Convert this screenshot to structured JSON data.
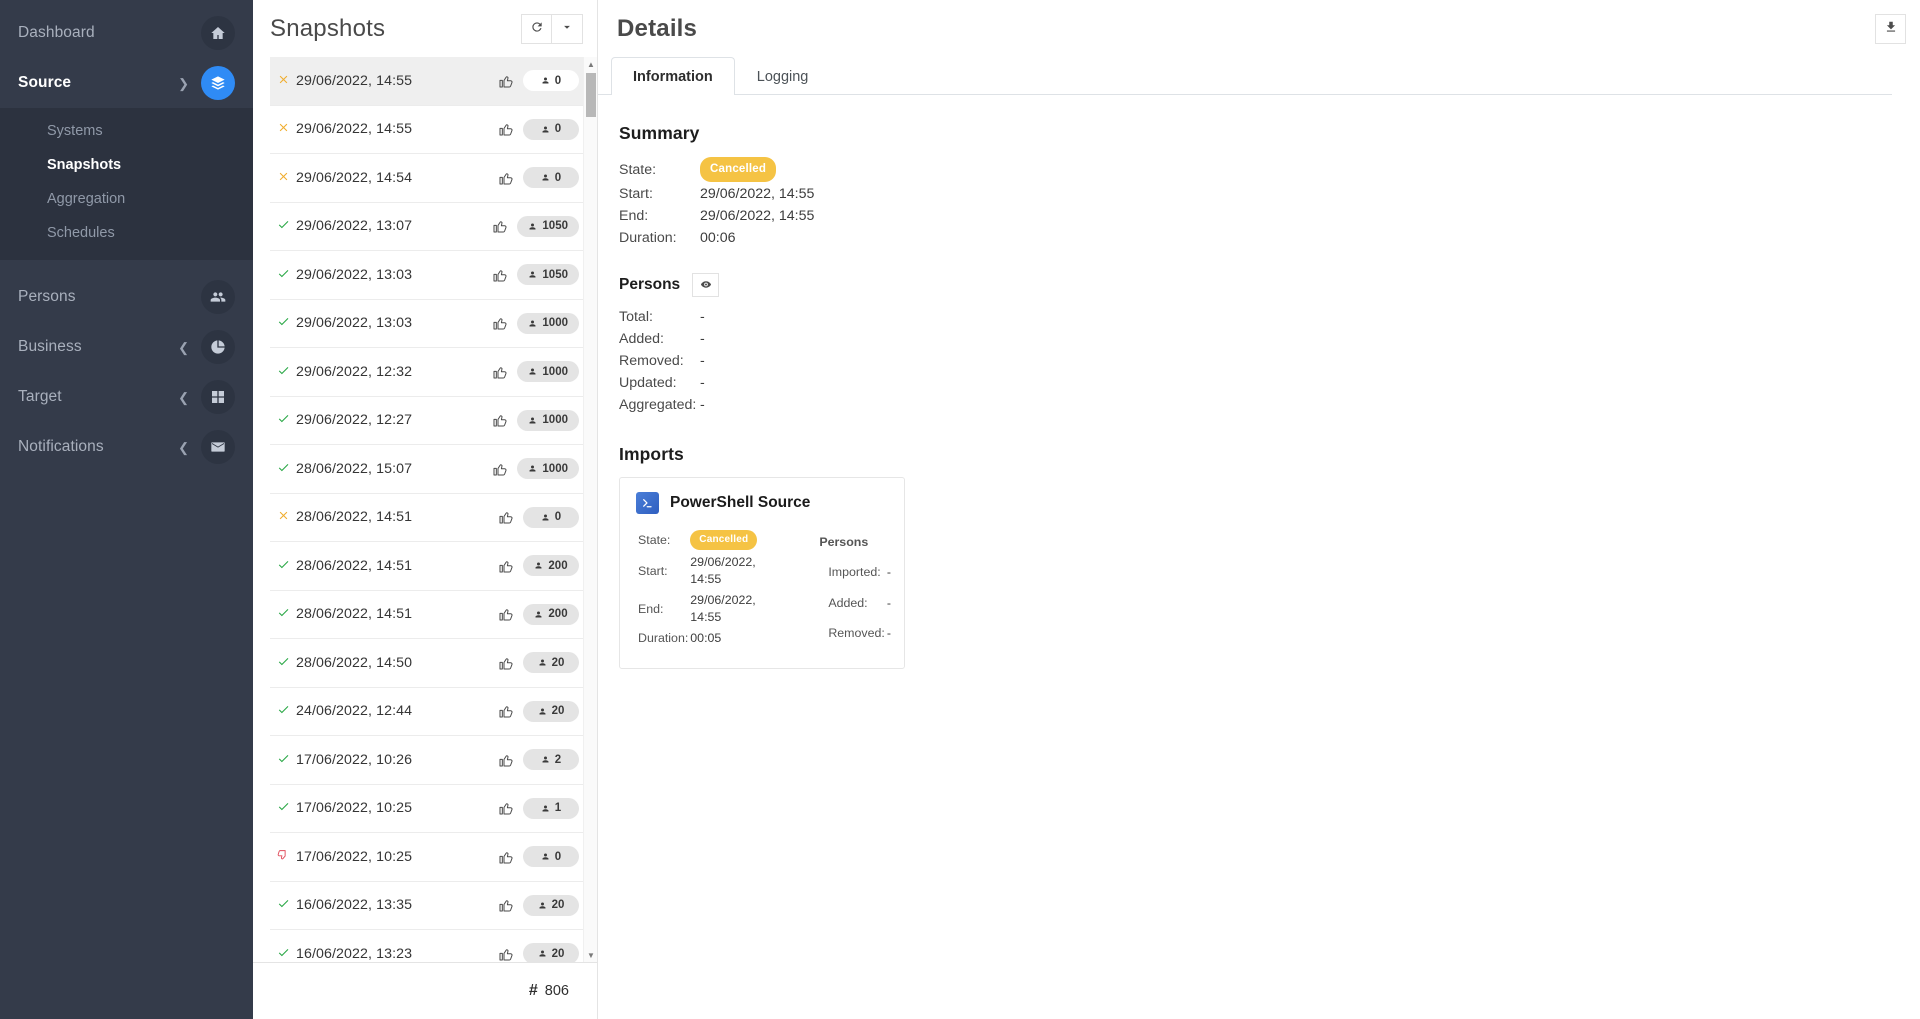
{
  "sidebar": {
    "items": [
      {
        "label": "Dashboard",
        "icon": "home-icon",
        "active": false,
        "chevron": "",
        "accent": false
      },
      {
        "label": "Source",
        "icon": "layers-icon",
        "active": true,
        "chevron": "down",
        "accent": true
      },
      {
        "label": "Persons",
        "icon": "users-icon",
        "active": false,
        "chevron": "",
        "accent": false
      },
      {
        "label": "Business",
        "icon": "pie-chart-icon",
        "active": false,
        "chevron": "left",
        "accent": false
      },
      {
        "label": "Target",
        "icon": "grid-icon",
        "active": false,
        "chevron": "left",
        "accent": false
      },
      {
        "label": "Notifications",
        "icon": "envelope-icon",
        "active": false,
        "chevron": "left",
        "accent": false
      }
    ],
    "subnav": [
      {
        "label": "Systems",
        "active": false
      },
      {
        "label": "Snapshots",
        "active": true
      },
      {
        "label": "Aggregation",
        "active": false
      },
      {
        "label": "Schedules",
        "active": false
      }
    ]
  },
  "snapshots_panel": {
    "title": "Snapshots",
    "refresh_icon": "refresh-icon",
    "dropdown_icon": "chevron-down-icon",
    "total_count": "806",
    "total_hash": "#",
    "rows": [
      {
        "state": "cancelled",
        "date": "29/06/2022, 14:55",
        "count": "0",
        "thumb": "up",
        "selected": true
      },
      {
        "state": "cancelled",
        "date": "29/06/2022, 14:55",
        "count": "0",
        "thumb": "up",
        "selected": false
      },
      {
        "state": "cancelled",
        "date": "29/06/2022, 14:54",
        "count": "0",
        "thumb": "up",
        "selected": false
      },
      {
        "state": "success",
        "date": "29/06/2022, 13:07",
        "count": "1050",
        "thumb": "up",
        "selected": false
      },
      {
        "state": "success",
        "date": "29/06/2022, 13:03",
        "count": "1050",
        "thumb": "up",
        "selected": false
      },
      {
        "state": "success",
        "date": "29/06/2022, 13:03",
        "count": "1000",
        "thumb": "up",
        "selected": false
      },
      {
        "state": "success",
        "date": "29/06/2022, 12:32",
        "count": "1000",
        "thumb": "up",
        "selected": false
      },
      {
        "state": "success",
        "date": "29/06/2022, 12:27",
        "count": "1000",
        "thumb": "up",
        "selected": false
      },
      {
        "state": "success",
        "date": "28/06/2022, 15:07",
        "count": "1000",
        "thumb": "up",
        "selected": false
      },
      {
        "state": "cancelled",
        "date": "28/06/2022, 14:51",
        "count": "0",
        "thumb": "up",
        "selected": false
      },
      {
        "state": "success",
        "date": "28/06/2022, 14:51",
        "count": "200",
        "thumb": "up",
        "selected": false
      },
      {
        "state": "success",
        "date": "28/06/2022, 14:51",
        "count": "200",
        "thumb": "up",
        "selected": false
      },
      {
        "state": "success",
        "date": "28/06/2022, 14:50",
        "count": "20",
        "thumb": "up",
        "selected": false
      },
      {
        "state": "success",
        "date": "24/06/2022, 12:44",
        "count": "20",
        "thumb": "up",
        "selected": false
      },
      {
        "state": "success",
        "date": "17/06/2022, 10:26",
        "count": "2",
        "thumb": "up",
        "selected": false
      },
      {
        "state": "success",
        "date": "17/06/2022, 10:25",
        "count": "1",
        "thumb": "up",
        "selected": false
      },
      {
        "state": "failed",
        "date": "17/06/2022, 10:25",
        "count": "0",
        "thumb": "up",
        "selected": false
      },
      {
        "state": "success",
        "date": "16/06/2022, 13:35",
        "count": "20",
        "thumb": "up",
        "selected": false
      },
      {
        "state": "success",
        "date": "16/06/2022, 13:23",
        "count": "20",
        "thumb": "up",
        "selected": false
      }
    ]
  },
  "details": {
    "title": "Details",
    "download_icon": "download-icon",
    "tabs": [
      {
        "label": "Information",
        "active": true
      },
      {
        "label": "Logging",
        "active": false
      }
    ],
    "summary": {
      "heading": "Summary",
      "state_label": "State:",
      "state_value": "Cancelled",
      "start_label": "Start:",
      "start_value": "29/06/2022, 14:55",
      "end_label": "End:",
      "end_value": "29/06/2022, 14:55",
      "duration_label": "Duration:",
      "duration_value": "00:06"
    },
    "persons": {
      "heading": "Persons",
      "eye_icon": "eye-icon",
      "rows": [
        {
          "label": "Total:",
          "value": "-"
        },
        {
          "label": "Added:",
          "value": "-"
        },
        {
          "label": "Removed:",
          "value": "-"
        },
        {
          "label": "Updated:",
          "value": "-"
        },
        {
          "label": "Aggregated:",
          "value": "-"
        }
      ]
    },
    "imports": {
      "heading": "Imports",
      "card": {
        "icon": "powershell-icon",
        "name": "PowerShell Source",
        "state_label": "State:",
        "state_value": "Cancelled",
        "start_label": "Start:",
        "start_value": "29/06/2022, 14:55",
        "end_label": "End:",
        "end_value": "29/06/2022, 14:55",
        "duration_label": "Duration:",
        "duration_value": "00:05",
        "persons_heading": "Persons",
        "persons_rows": [
          {
            "label": "Imported:",
            "value": "-"
          },
          {
            "label": "Added:",
            "value": "-"
          },
          {
            "label": "Removed:",
            "value": "-"
          }
        ]
      }
    }
  },
  "colors": {
    "sidebar_bg": "#343b4a",
    "subnav_bg": "#2c323f",
    "accent": "#2f8bf5",
    "state_success": "#28a745",
    "state_cancelled": "#f0ad2e",
    "state_failed": "#e04a59",
    "badge_warning": "#f5c344"
  }
}
